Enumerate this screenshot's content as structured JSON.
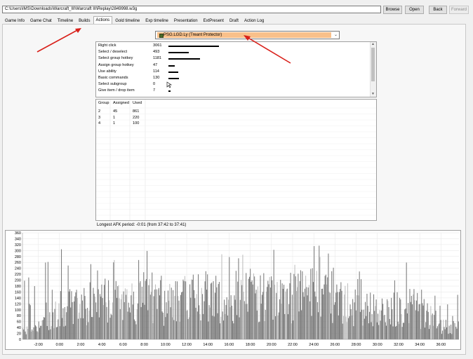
{
  "path": "C:\\Users\\IMS\\Downloads\\Warcraft_III\\Warcraft III\\Replay\\2849998.w3g",
  "buttons": {
    "browse": "Browse",
    "open": "Open",
    "back": "Back",
    "forward": "Forward"
  },
  "tabs": [
    "Game Info",
    "Game Chat",
    "Timeline",
    "Builds",
    "Actions",
    "Gold timeline",
    "Exp timeline",
    "Presentation",
    "ExtPresent",
    "Draft",
    "Action Log"
  ],
  "active_tab": "Actions",
  "player": "PSG.LGD.Ly (Treant Protector)",
  "actions": [
    {
      "name": "Right click",
      "count": "3061",
      "value": 3061
    },
    {
      "name": "Select / deselect",
      "count": "493",
      "value": 493
    },
    {
      "name": "Select group hotkey",
      "count": "1181",
      "value": 1181
    },
    {
      "name": "Assign group hotkey",
      "count": "47",
      "value": 47
    },
    {
      "name": "Use ability",
      "count": "114",
      "value": 114
    },
    {
      "name": "Basic commands",
      "count": "130",
      "value": 130
    },
    {
      "name": "Select subgroup",
      "count": "0",
      "value": 0
    },
    {
      "name": "Give item / drop item",
      "count": "7",
      "value": 7
    }
  ],
  "groups": {
    "headers": [
      "Group",
      "Assigned",
      "Used"
    ],
    "rows": [
      [
        "2",
        "45",
        "861"
      ],
      [
        "3",
        "1",
        "220"
      ],
      [
        "4",
        "1",
        "100"
      ]
    ]
  },
  "afk_text": "Longest AFK period: -0:01 (from 37:42 to 37:41)",
  "colors": {
    "accent_arrow": "#d9201a",
    "bar_gray": "#7a7a7a",
    "bar_light": "#bdbdbd",
    "selection": "#f9c08a"
  },
  "chart_data": {
    "type": "bar",
    "title": "",
    "xlabel": "",
    "ylabel": "",
    "ylim": [
      0,
      360
    ],
    "yticks": [
      "0",
      "20",
      "40",
      "60",
      "80",
      "100",
      "120",
      "140",
      "160",
      "180",
      "200",
      "220",
      "240",
      "260",
      "280",
      "300",
      "320",
      "340",
      "360"
    ],
    "xlim_seconds": [
      -210,
      2262
    ],
    "xtick_labels": [
      "-2:00",
      "0:00",
      "2:00",
      "4:00",
      "6:00",
      "8:00",
      "10:00",
      "12:00",
      "14:00",
      "16:00",
      "18:00",
      "20:00",
      "22:00",
      "24:00",
      "26:00",
      "28:00",
      "30:00",
      "32:00",
      "34:00",
      "36:00"
    ],
    "xtick_seconds": [
      -120,
      0,
      120,
      240,
      360,
      480,
      600,
      720,
      840,
      960,
      1080,
      1200,
      1320,
      1440,
      1560,
      1680,
      1800,
      1920,
      2040,
      2160
    ],
    "grid": true,
    "series": [
      {
        "bin_start_seconds": -210,
        "bin_seconds": 60,
        "values": [
          40,
          55,
          70,
          100,
          120,
          130,
          125,
          150,
          140,
          135,
          145,
          160,
          150,
          130,
          140,
          150,
          145,
          160,
          140,
          130,
          145,
          155,
          160,
          150,
          140,
          150,
          165,
          170,
          160,
          155,
          140,
          120,
          110,
          100,
          90,
          110,
          120,
          100,
          80,
          50,
          40,
          90
        ],
        "peaks": [
          340,
          280,
          300,
          320,
          360,
          300,
          280,
          300,
          290,
          310,
          280,
          300,
          270,
          340,
          300,
          270,
          260,
          320,
          300,
          330,
          310,
          280,
          300,
          330,
          350,
          290,
          260,
          330,
          300,
          300,
          250,
          230,
          260,
          230,
          220,
          240,
          280,
          230,
          170,
          130,
          190,
          200
        ]
      }
    ]
  }
}
